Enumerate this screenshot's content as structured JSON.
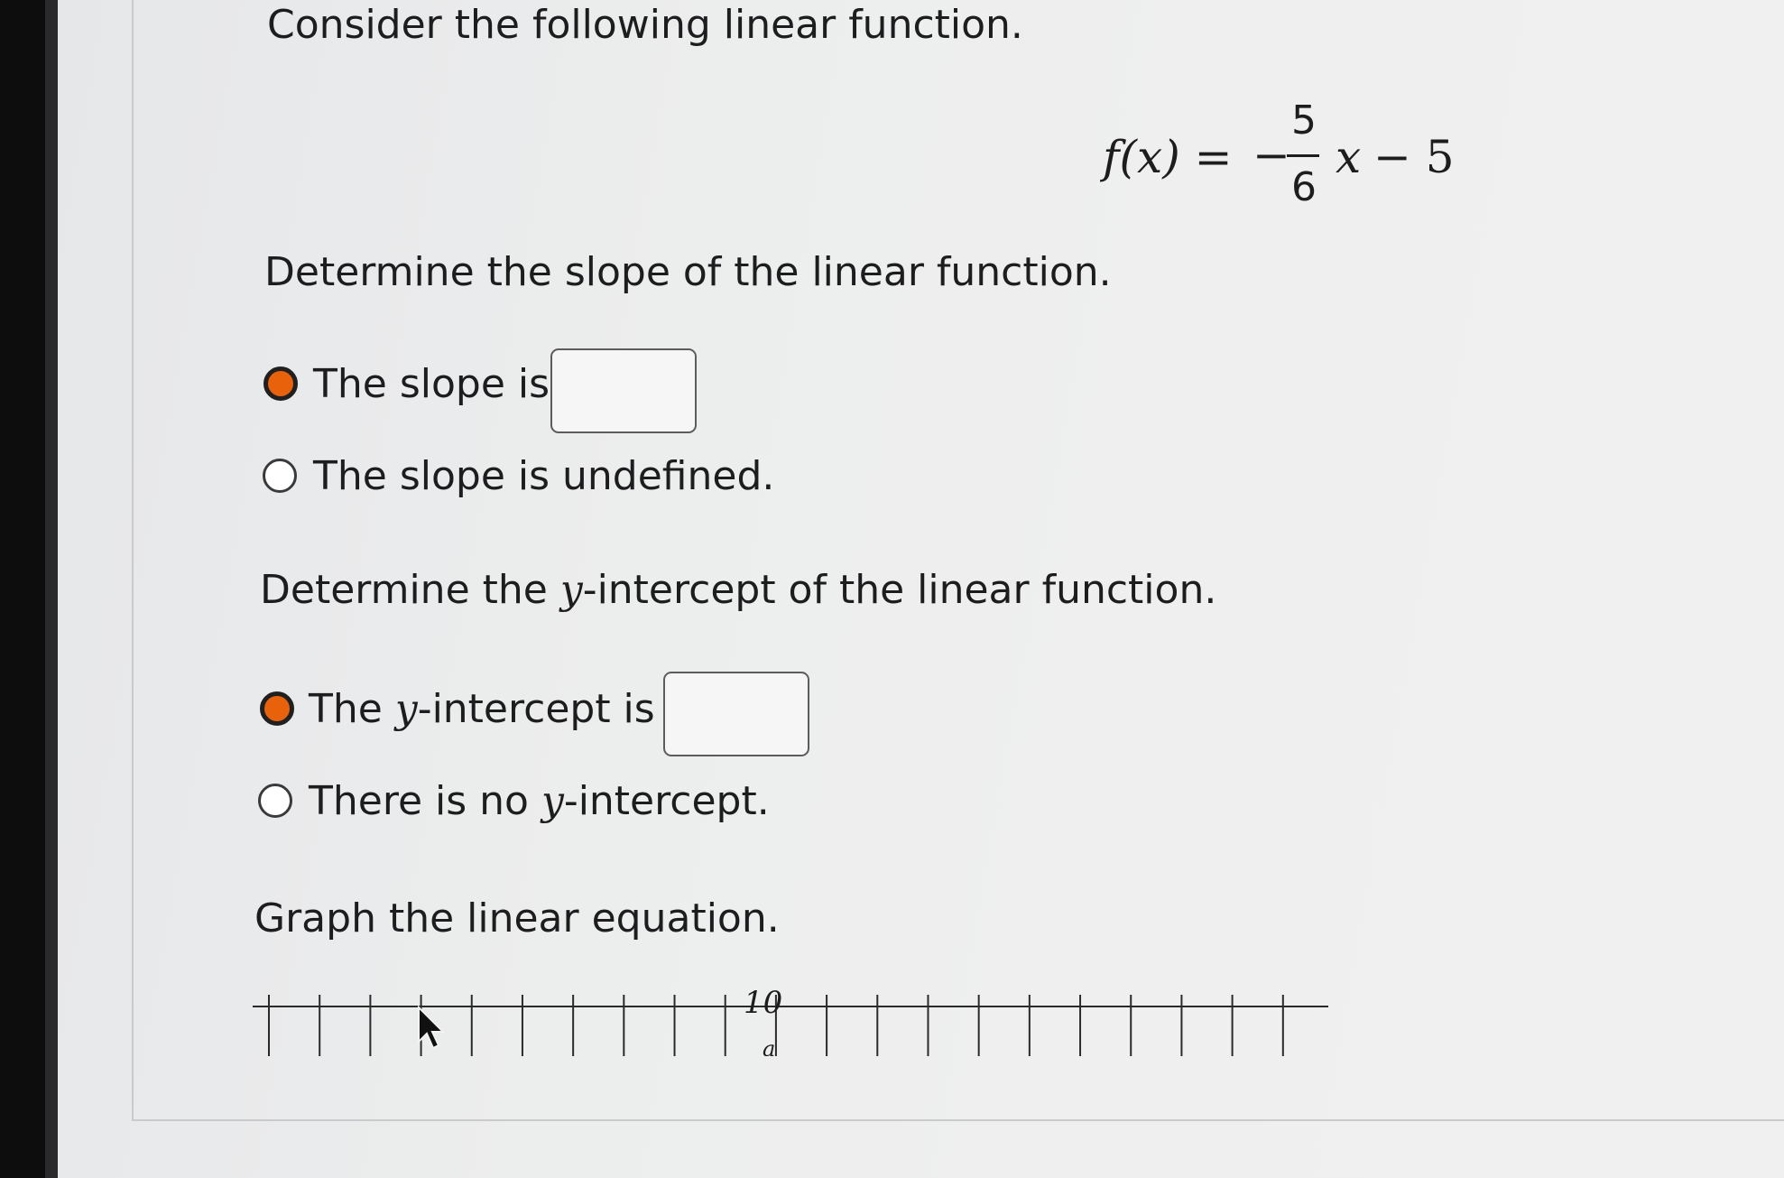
{
  "question": {
    "intro": "Consider the following linear function.",
    "formula": {
      "lhs": "f(x) =",
      "sign": "−",
      "numerator": "5",
      "denominator": "6",
      "variable": "x",
      "tail": "− 5"
    }
  },
  "slope_section": {
    "prompt": "Determine the slope of the linear function.",
    "options": [
      {
        "label": "The slope is",
        "selected": true,
        "has_input": true,
        "input_value": ""
      },
      {
        "label": "The slope is undefined.",
        "selected": false,
        "has_input": false
      }
    ]
  },
  "intercept_section": {
    "prompt_pre": "Determine the ",
    "prompt_var": "y",
    "prompt_post": "-intercept of the linear function.",
    "options": [
      {
        "pre": "The ",
        "var": "y",
        "post": "-intercept is",
        "selected": true,
        "has_input": true,
        "input_value": ""
      },
      {
        "pre": "There is no ",
        "var": "y",
        "post": "-intercept.",
        "selected": false,
        "has_input": false
      }
    ]
  },
  "graph_section": {
    "prompt": "Graph the linear equation.",
    "axis_label": "10",
    "tick_count": 21
  },
  "colors": {
    "radio_selected": "#e8620c",
    "text": "#1d1d1f"
  }
}
